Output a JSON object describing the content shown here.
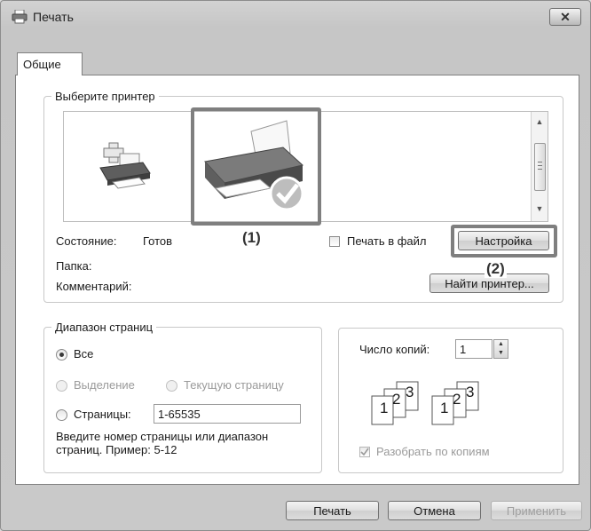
{
  "window": {
    "title": "Печать",
    "close_glyph": "✕"
  },
  "tabs": [
    {
      "label": "Общие",
      "selected": true
    }
  ],
  "printer_group": {
    "legend": "Выберите принтер",
    "printers": [
      {
        "icon": "add-printer-icon",
        "selected": false
      },
      {
        "icon": "default-printer-icon",
        "selected": true
      }
    ],
    "status_label": "Состояние:",
    "status_value": "Готов",
    "folder_label": "Папка:",
    "comment_label": "Комментарий:",
    "print_to_file_label": "Печать в файл",
    "print_to_file_checked": false,
    "preferences_button": "Настройка",
    "find_printer_button": "Найти принтер..."
  },
  "callouts": {
    "one": "(1)",
    "two": "(2)"
  },
  "page_range": {
    "legend": "Диапазон страниц",
    "all_label": "Все",
    "selection_label": "Выделение",
    "current_page_label": "Текущую страницу",
    "pages_label": "Страницы:",
    "pages_value": "1-65535",
    "selected_option": "all",
    "hint": "Введите номер страницы или диапазон страниц.  Пример: 5-12"
  },
  "copies": {
    "label": "Число копий:",
    "value": "1",
    "collate_label": "Разобрать по копиям",
    "collate_checked": true,
    "collate_pages": [
      "1",
      "2",
      "3"
    ]
  },
  "buttons": {
    "print": "Печать",
    "cancel": "Отмена",
    "apply": "Применить"
  },
  "colors": {
    "highlight": "#7f7f7f",
    "window_bg": "#c9c9c9",
    "panel_bg": "#ffffff"
  }
}
